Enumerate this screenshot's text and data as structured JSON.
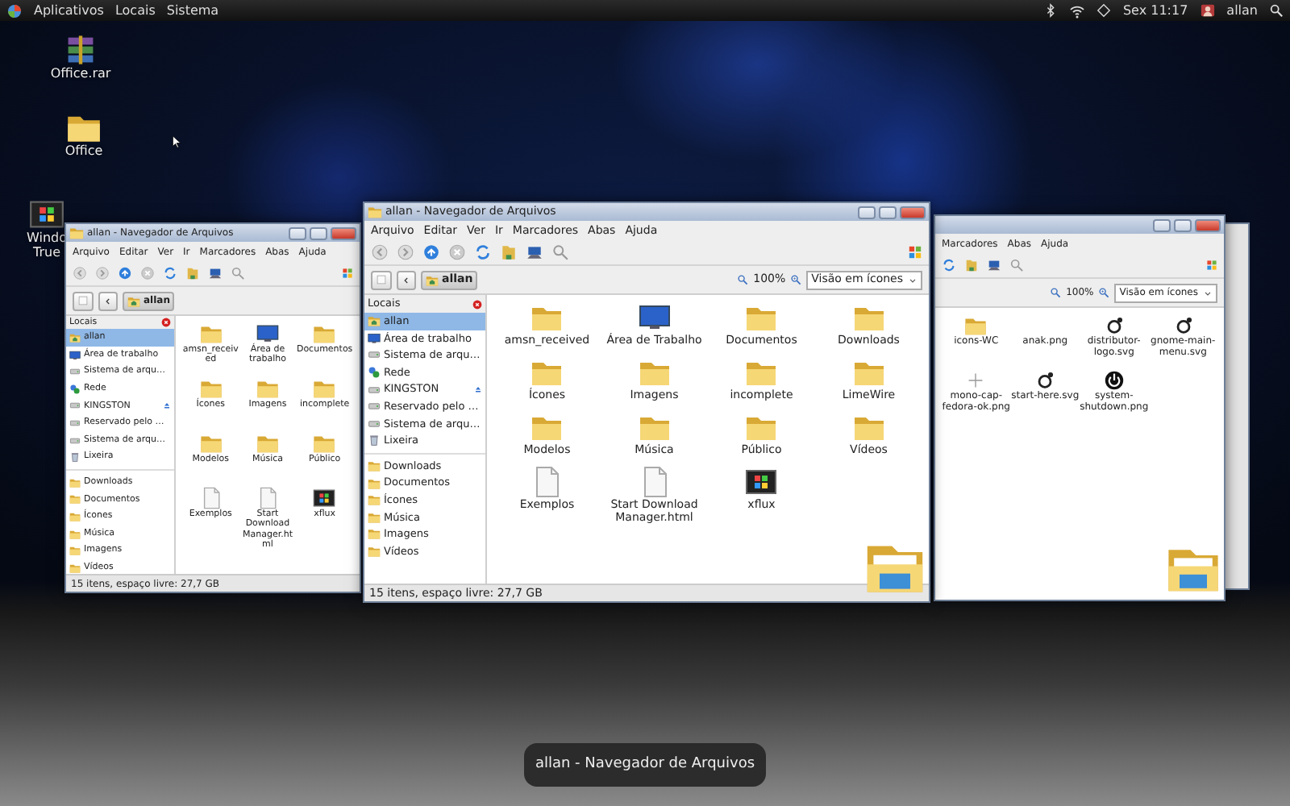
{
  "top_panel": {
    "menus": [
      "Aplicativos",
      "Locais",
      "Sistema"
    ],
    "clock": "Sex 11:17",
    "user": "allan"
  },
  "desktop_icons": [
    {
      "label": "Office.rar",
      "kind": "archive"
    },
    {
      "label": "Office",
      "kind": "folder"
    },
    {
      "label": "Windo True",
      "kind": "program"
    }
  ],
  "windows": [
    {
      "kind": "left",
      "title": "allan - Navegador de Arquivos",
      "menu": [
        "Arquivo",
        "Editar",
        "Ver",
        "Ir",
        "Marcadores",
        "Abas",
        "Ajuda"
      ],
      "location": "allan",
      "sidebar": {
        "header": "Locais",
        "places": [
          {
            "label": "allan",
            "kind": "home",
            "selected": true,
            "eject": false
          },
          {
            "label": "Área de trabalho",
            "kind": "monitor",
            "selected": false,
            "eject": false
          },
          {
            "label": "Sistema de arqu…",
            "kind": "drive",
            "selected": false,
            "eject": false
          },
          {
            "label": "Rede",
            "kind": "network",
            "selected": false,
            "eject": false
          },
          {
            "label": "KINGSTON",
            "kind": "drive",
            "selected": false,
            "eject": true
          },
          {
            "label": "Reservado pelo …",
            "kind": "drive",
            "selected": false,
            "eject": false
          },
          {
            "label": "Sistema de arqu…",
            "kind": "drive",
            "selected": false,
            "eject": false
          },
          {
            "label": "Lixeira",
            "kind": "trash",
            "selected": false,
            "eject": false
          }
        ],
        "bookmarks": [
          "Downloads",
          "Documentos",
          "Ícones",
          "Música",
          "Imagens",
          "Vídeos"
        ]
      },
      "items": [
        {
          "label": "amsn_received",
          "kind": "folder"
        },
        {
          "label": "Área de trabalho",
          "kind": "monitor"
        },
        {
          "label": "Documentos",
          "kind": "folder"
        },
        {
          "label": "Ícones",
          "kind": "folder"
        },
        {
          "label": "Imagens",
          "kind": "folder"
        },
        {
          "label": "incomplete",
          "kind": "folder"
        },
        {
          "label": "Modelos",
          "kind": "folder"
        },
        {
          "label": "Música",
          "kind": "folder"
        },
        {
          "label": "Público",
          "kind": "folder"
        },
        {
          "label": "Exemplos",
          "kind": "document"
        },
        {
          "label": "Start Download Manager.html",
          "kind": "document"
        },
        {
          "label": "xflux",
          "kind": "program"
        }
      ],
      "status": "15 itens, espaço livre: 27,7 GB"
    },
    {
      "kind": "center",
      "title": "allan - Navegador de Arquivos",
      "menu": [
        "Arquivo",
        "Editar",
        "Ver",
        "Ir",
        "Marcadores",
        "Abas",
        "Ajuda"
      ],
      "location": "allan",
      "zoom": "100%",
      "view": "Visão em ícones",
      "sidebar": {
        "header": "Locais",
        "places": [
          {
            "label": "allan",
            "kind": "home",
            "selected": true,
            "eject": false
          },
          {
            "label": "Área de trabalho",
            "kind": "monitor",
            "selected": false,
            "eject": false
          },
          {
            "label": "Sistema de arqu…",
            "kind": "drive",
            "selected": false,
            "eject": false
          },
          {
            "label": "Rede",
            "kind": "network",
            "selected": false,
            "eject": false
          },
          {
            "label": "KINGSTON",
            "kind": "drive",
            "selected": false,
            "eject": true
          },
          {
            "label": "Reservado pelo …",
            "kind": "drive",
            "selected": false,
            "eject": false
          },
          {
            "label": "Sistema de arqu…",
            "kind": "drive",
            "selected": false,
            "eject": false
          },
          {
            "label": "Lixeira",
            "kind": "trash",
            "selected": false,
            "eject": false
          }
        ],
        "bookmarks": [
          "Downloads",
          "Documentos",
          "Ícones",
          "Música",
          "Imagens",
          "Vídeos"
        ]
      },
      "items": [
        {
          "label": "amsn_received",
          "kind": "folder"
        },
        {
          "label": "Área de Trabalho",
          "kind": "monitor"
        },
        {
          "label": "Documentos",
          "kind": "folder"
        },
        {
          "label": "Downloads",
          "kind": "folder"
        },
        {
          "label": "Ícones",
          "kind": "folder"
        },
        {
          "label": "Imagens",
          "kind": "folder"
        },
        {
          "label": "incomplete",
          "kind": "folder"
        },
        {
          "label": "LimeWire",
          "kind": "folder"
        },
        {
          "label": "Modelos",
          "kind": "folder"
        },
        {
          "label": "Música",
          "kind": "folder"
        },
        {
          "label": "Público",
          "kind": "folder"
        },
        {
          "label": "Vídeos",
          "kind": "folder"
        },
        {
          "label": "Exemplos",
          "kind": "document"
        },
        {
          "label": "Start Download Manager.html",
          "kind": "document"
        },
        {
          "label": "xflux",
          "kind": "program"
        }
      ],
      "status": "15 itens, espaço livre: 27,7 GB"
    },
    {
      "kind": "right",
      "menu": [
        "Marcadores",
        "Abas",
        "Ajuda"
      ],
      "zoom": "100%",
      "view": "Visão em ícones",
      "items": [
        {
          "label": "icons-WC",
          "kind": "folder"
        },
        {
          "label": "anak.png",
          "kind": "none"
        },
        {
          "label": "distributor-logo.svg",
          "kind": "logo"
        },
        {
          "label": "gnome-main-menu.svg",
          "kind": "logo"
        },
        {
          "label": "mono-cap-fedora-ok.png",
          "kind": "sparkle"
        },
        {
          "label": "start-here.svg",
          "kind": "logo"
        },
        {
          "label": "system-shutdown.png",
          "kind": "power"
        }
      ]
    }
  ],
  "switcher_caption": "allan - Navegador de Arquivos"
}
